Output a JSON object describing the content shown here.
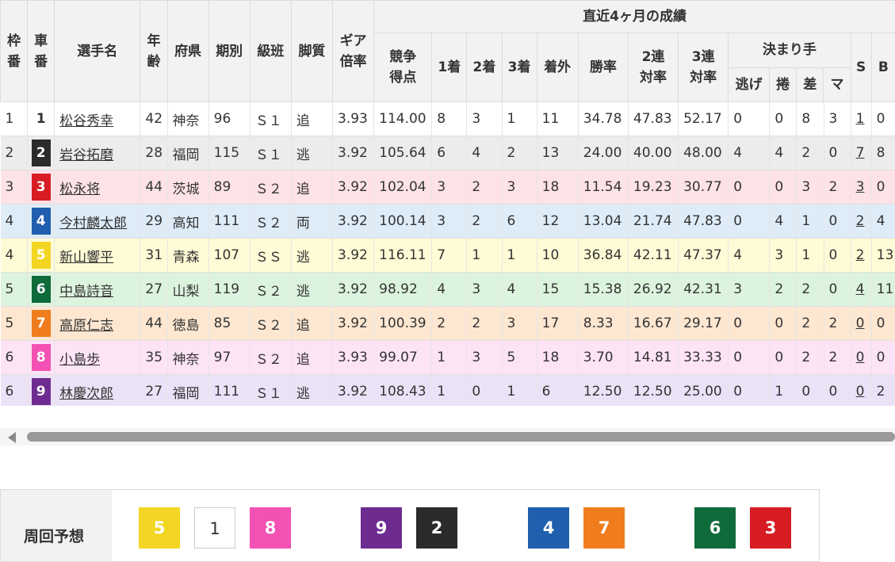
{
  "header": {
    "waku": "枠番",
    "sha": "車番",
    "name": "選手名",
    "age": "年齢",
    "pref": "府県",
    "term": "期別",
    "class": "級班",
    "style": "脚質",
    "gear": "ギア倍率",
    "recent": "直近4ヶ月の成績",
    "score": "競争得点",
    "first": "1着",
    "second": "2着",
    "third": "3着",
    "out": "着外",
    "winrate": "勝率",
    "rate2": "2連対率",
    "rate3": "3連対率",
    "kimarite": "決まり手",
    "nige": "逃げ",
    "makuri": "捲",
    "sashi": "差",
    "ma": "マ",
    "s": "S",
    "b": "B"
  },
  "colors": {
    "1": {
      "bg": "#ffffff",
      "fg": "#333333",
      "border": "#cccccc",
      "row": "#ffffff"
    },
    "2": {
      "bg": "#2b2b2b",
      "fg": "#ffffff",
      "row": "#ececec"
    },
    "3": {
      "bg": "#d71c24",
      "fg": "#ffffff",
      "row": "#fde2e7"
    },
    "4": {
      "bg": "#1f5fad",
      "fg": "#ffffff",
      "row": "#deecf8"
    },
    "5": {
      "bg": "#f3d624",
      "fg": "#ffffff",
      "row": "#fffbd6"
    },
    "6": {
      "bg": "#0f6b3a",
      "fg": "#ffffff",
      "row": "#dcf3dd"
    },
    "7": {
      "bg": "#ef7d1d",
      "fg": "#ffffff",
      "row": "#fde7d1"
    },
    "8": {
      "bg": "#f351b3",
      "fg": "#ffffff",
      "row": "#fde3f6"
    },
    "9": {
      "bg": "#6e2c90",
      "fg": "#ffffff",
      "row": "#ece2f7"
    }
  },
  "riders": [
    {
      "waku": "1",
      "sha": "1",
      "name": "松谷秀幸",
      "age": "42",
      "pref": "神奈",
      "term": "96",
      "class": "Ｓ１",
      "style": "追",
      "gear": "3.93",
      "score": "114.00",
      "first": "8",
      "second": "3",
      "third": "1",
      "out": "11",
      "winrate": "34.78",
      "rate2": "47.83",
      "rate3": "52.17",
      "nige": "0",
      "makuri": "0",
      "sashi": "8",
      "ma": "3",
      "s": "1",
      "b": "0"
    },
    {
      "waku": "2",
      "sha": "2",
      "name": "岩谷拓磨",
      "age": "28",
      "pref": "福岡",
      "term": "115",
      "class": "Ｓ１",
      "style": "逃",
      "gear": "3.92",
      "score": "105.64",
      "first": "6",
      "second": "4",
      "third": "2",
      "out": "13",
      "winrate": "24.00",
      "rate2": "40.00",
      "rate3": "48.00",
      "nige": "4",
      "makuri": "4",
      "sashi": "2",
      "ma": "0",
      "s": "7",
      "b": "8"
    },
    {
      "waku": "3",
      "sha": "3",
      "name": "松永将",
      "age": "44",
      "pref": "茨城",
      "term": "89",
      "class": "Ｓ２",
      "style": "追",
      "gear": "3.92",
      "score": "102.04",
      "first": "3",
      "second": "2",
      "third": "3",
      "out": "18",
      "winrate": "11.54",
      "rate2": "19.23",
      "rate3": "30.77",
      "nige": "0",
      "makuri": "0",
      "sashi": "3",
      "ma": "2",
      "s": "3",
      "b": "0"
    },
    {
      "waku": "4",
      "sha": "4",
      "name": "今村麟太郎",
      "age": "29",
      "pref": "高知",
      "term": "111",
      "class": "Ｓ２",
      "style": "両",
      "gear": "3.92",
      "score": "100.14",
      "first": "3",
      "second": "2",
      "third": "6",
      "out": "12",
      "winrate": "13.04",
      "rate2": "21.74",
      "rate3": "47.83",
      "nige": "0",
      "makuri": "4",
      "sashi": "1",
      "ma": "0",
      "s": "2",
      "b": "4"
    },
    {
      "waku": "4",
      "sha": "5",
      "name": "新山響平",
      "age": "31",
      "pref": "青森",
      "term": "107",
      "class": "ＳＳ",
      "style": "逃",
      "gear": "3.92",
      "score": "116.11",
      "first": "7",
      "second": "1",
      "third": "1",
      "out": "10",
      "winrate": "36.84",
      "rate2": "42.11",
      "rate3": "47.37",
      "nige": "4",
      "makuri": "3",
      "sashi": "1",
      "ma": "0",
      "s": "2",
      "b": "13"
    },
    {
      "waku": "5",
      "sha": "6",
      "name": "中島詩音",
      "age": "27",
      "pref": "山梨",
      "term": "119",
      "class": "Ｓ２",
      "style": "逃",
      "gear": "3.92",
      "score": "98.92",
      "first": "4",
      "second": "3",
      "third": "4",
      "out": "15",
      "winrate": "15.38",
      "rate2": "26.92",
      "rate3": "42.31",
      "nige": "3",
      "makuri": "2",
      "sashi": "2",
      "ma": "0",
      "s": "4",
      "b": "11"
    },
    {
      "waku": "5",
      "sha": "7",
      "name": "高原仁志",
      "age": "44",
      "pref": "徳島",
      "term": "85",
      "class": "Ｓ２",
      "style": "追",
      "gear": "3.92",
      "score": "100.39",
      "first": "2",
      "second": "2",
      "third": "3",
      "out": "17",
      "winrate": "8.33",
      "rate2": "16.67",
      "rate3": "29.17",
      "nige": "0",
      "makuri": "0",
      "sashi": "2",
      "ma": "2",
      "s": "0",
      "b": "0"
    },
    {
      "waku": "6",
      "sha": "8",
      "name": "小島歩",
      "age": "35",
      "pref": "神奈",
      "term": "97",
      "class": "Ｓ２",
      "style": "追",
      "gear": "3.93",
      "score": "99.07",
      "first": "1",
      "second": "3",
      "third": "5",
      "out": "18",
      "winrate": "3.70",
      "rate2": "14.81",
      "rate3": "33.33",
      "nige": "0",
      "makuri": "0",
      "sashi": "2",
      "ma": "2",
      "s": "0",
      "b": "0"
    },
    {
      "waku": "6",
      "sha": "9",
      "name": "林慶次郎",
      "age": "27",
      "pref": "福岡",
      "term": "111",
      "class": "Ｓ１",
      "style": "逃",
      "gear": "3.92",
      "score": "108.43",
      "first": "1",
      "second": "0",
      "third": "1",
      "out": "6",
      "winrate": "12.50",
      "rate2": "12.50",
      "rate3": "25.00",
      "nige": "0",
      "makuri": "1",
      "sashi": "0",
      "ma": "0",
      "s": "0",
      "b": "2"
    }
  ],
  "lap": {
    "label": "周回予想",
    "order": [
      "5",
      "1",
      "8",
      "9",
      "2",
      "4",
      "7",
      "6",
      "3"
    ]
  }
}
